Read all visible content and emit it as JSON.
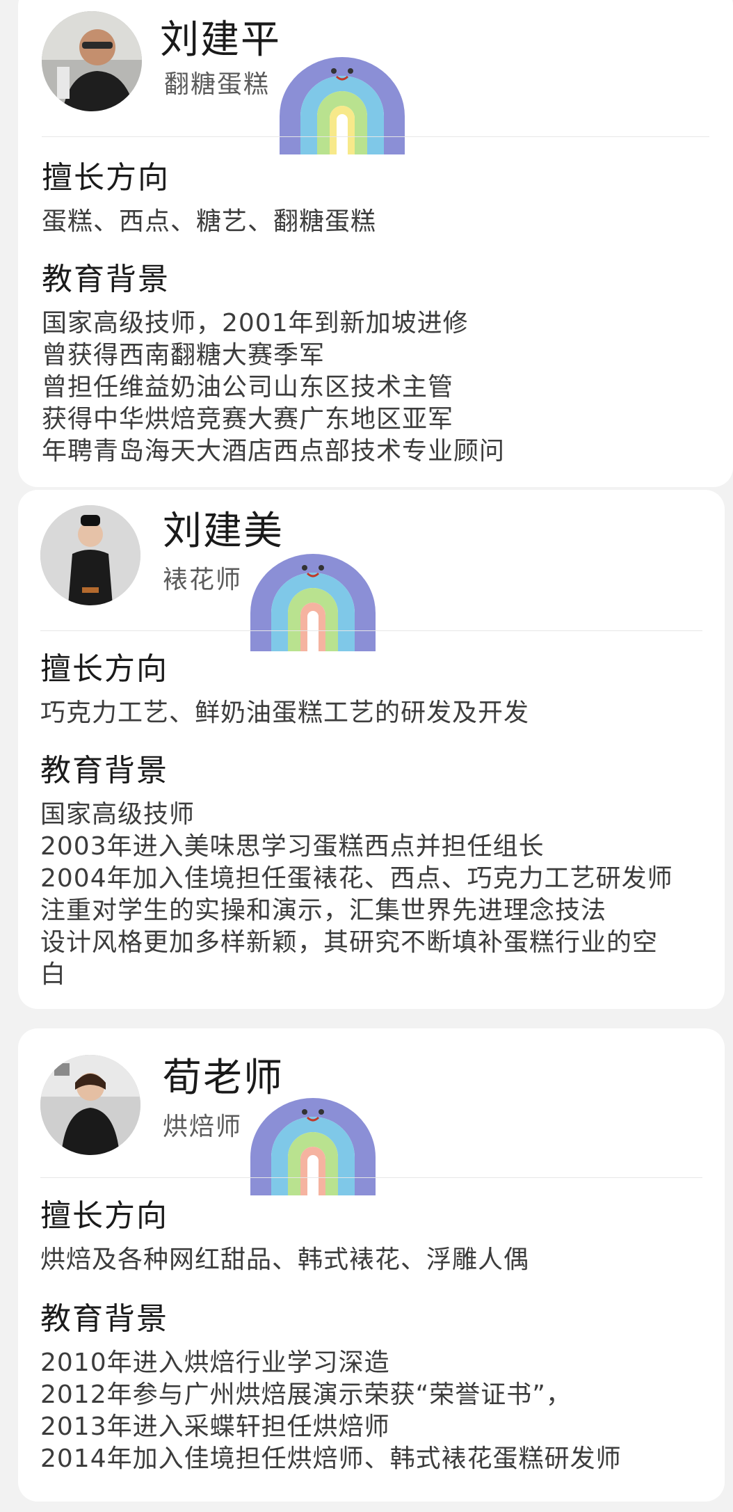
{
  "teachers": [
    {
      "name": "刘建平",
      "role": "翻糖蛋糕",
      "specialty_title": "擅长方向",
      "specialty": "蛋糕、西点、糖艺、翻糖蛋糕",
      "education_title": "教育背景",
      "education": [
        "国家高级技师，2001年到新加坡进修",
        "曾获得西南翻糖大赛季军",
        "曾担任维益奶油公司山东区技术主管",
        "获得中华烘焙竞赛大赛广东地区亚军",
        "年聘青岛海天大酒店西点部技术专业顾问"
      ]
    },
    {
      "name": "刘建美",
      "role": "裱花师",
      "specialty_title": "擅长方向",
      "specialty": "巧克力工艺、鲜奶油蛋糕工艺的研发及开发",
      "education_title": "教育背景",
      "education": [
        "国家高级技师",
        "2003年进入美味思学习蛋糕西点并担任组长",
        "2004年加入佳境担任蛋裱花、西点、巧克力工艺研发师",
        "注重对学生的实操和演示，汇集世界先进理念技法",
        "设计风格更加多样新颖，其研究不断填补蛋糕行业的空",
        "白"
      ]
    },
    {
      "name": "荀老师",
      "role": "烘焙师",
      "specialty_title": "擅长方向",
      "specialty": "烘焙及各种网红甜品、韩式裱花、浮雕人偶",
      "education_title": "教育背景",
      "education": [
        "2010年进入烘焙行业学习深造",
        "2012年参与广州烘焙展演示荣获“荣誉证书”，",
        "2013年进入采蝶轩担任烘焙师",
        "2014年加入佳境担任烘焙师、韩式裱花蛋糕研发师"
      ]
    }
  ],
  "colors": {
    "background": "#f2f2f2",
    "card": "#ffffff",
    "rainbow": [
      "#8b8fd6",
      "#7fc8e8",
      "#b9e28f",
      "#f7e98a",
      "#f5b3a0"
    ]
  },
  "icons": {
    "avatar": "person-photo",
    "sticker": "rainbow-face-sticker"
  }
}
